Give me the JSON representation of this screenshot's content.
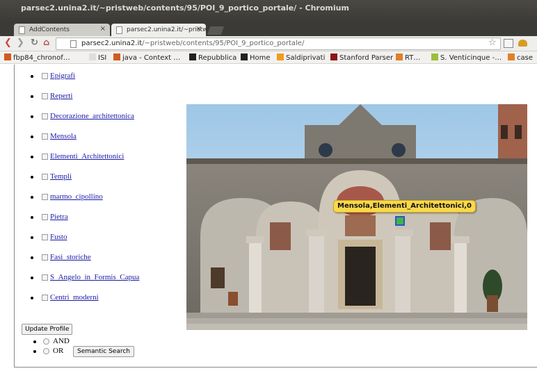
{
  "window": {
    "title": "parsec2.unina2.it/~pristweb/contents/95/POI_9_portico_portale/ - Chromium"
  },
  "tabs": [
    {
      "label": "AddContents",
      "close": "×"
    },
    {
      "label": "parsec2.unina2.it/~pristw",
      "close": "×"
    }
  ],
  "toolbar": {
    "back": "❮",
    "forward": "❯",
    "reload": "↻",
    "home": "⌂",
    "url_host": "parsec2.unina2.it",
    "url_path": "/~pristweb/contents/95/POI_9_portico_portale/",
    "star": "☆"
  },
  "bookmarks": [
    {
      "label": "fbp84_chronof…",
      "icon": "java-icon",
      "color": "#d35a1f"
    },
    {
      "label": "ISI",
      "icon": "page-icon",
      "color": "#dddddd"
    },
    {
      "label": "java - Context …",
      "icon": "java-icon",
      "color": "#d35a1f"
    },
    {
      "label": "Repubblica",
      "icon": "repubblica-icon",
      "color": "#222222"
    },
    {
      "label": "Home",
      "icon": "home-icon",
      "color": "#222222"
    },
    {
      "label": "Saldiprivati",
      "icon": "saldiprivati-icon",
      "color": "#f39a1e"
    },
    {
      "label": "Stanford Parser",
      "icon": "stanford-icon",
      "color": "#8c1515"
    },
    {
      "label": "RT…",
      "icon": "folder-icon",
      "color": "#e0802a"
    },
    {
      "label": "S. Venticinque -…",
      "icon": "star-icon",
      "color": "#9abf3a"
    },
    {
      "label": "case",
      "icon": "folder-icon",
      "color": "#e0802a"
    }
  ],
  "categories": [
    "Epigrafi",
    "Reperti",
    "Decorazione_architettonica",
    "Mensola",
    "Elementi_Architettonici",
    "Templi",
    "marmo_cipollino",
    "Pietra",
    "Fusto",
    "Fasi_storiche",
    "S_Angelo_in_Formis_Capua",
    "Centri_moderni"
  ],
  "update_profile_label": "Update Profile",
  "operators": [
    "AND",
    "OR"
  ],
  "semantic_search_label": "Semantic Search",
  "tooltip": "Mensola,Elementi_Architettonici,0"
}
